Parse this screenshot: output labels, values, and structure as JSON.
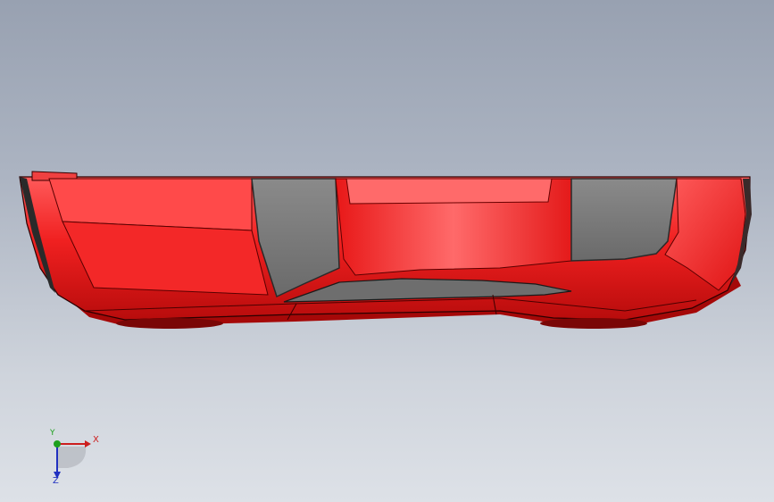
{
  "viewport": {
    "background_top": "#98a1b1",
    "background_bottom": "#dde1e7"
  },
  "model": {
    "body_color": "#e81818",
    "glass_color": "#7c7c7c"
  },
  "triad": {
    "x_label": "X",
    "y_label": "Y",
    "z_label": "Z",
    "x_color": "#cc1e1e",
    "y_color": "#1ea01e",
    "z_color": "#2030c0"
  }
}
